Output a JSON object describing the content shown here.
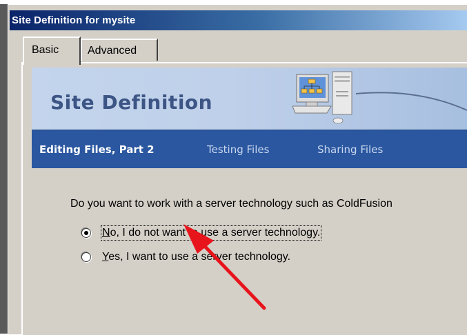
{
  "window": {
    "title": "Site Definition for mysite"
  },
  "tabs": [
    {
      "label": "Basic",
      "active": true
    },
    {
      "label": "Advanced",
      "active": false
    }
  ],
  "header": {
    "title": "Site Definition",
    "icon": "networked-computer-icon"
  },
  "steps": [
    {
      "label": "Editing Files, Part 2",
      "active": true
    },
    {
      "label": "Testing Files",
      "active": false
    },
    {
      "label": "Sharing Files",
      "active": false
    }
  ],
  "question": {
    "text": "Do you want to work with a server technology such as ColdFusion"
  },
  "options": [
    {
      "mnemonic": "N",
      "rest": "o, I do not want to use a server technology.",
      "selected": true
    },
    {
      "mnemonic": "Y",
      "rest": "es, I want to use a server technology.",
      "selected": false
    }
  ],
  "annotation": {
    "icon": "red-arrow-icon",
    "color": "#e8141b"
  },
  "colors": {
    "titlebar_start": "#0a246a",
    "nav_bar": "#2a57a0",
    "header_text": "#3c5585",
    "window_face": "#d4d0c8"
  }
}
